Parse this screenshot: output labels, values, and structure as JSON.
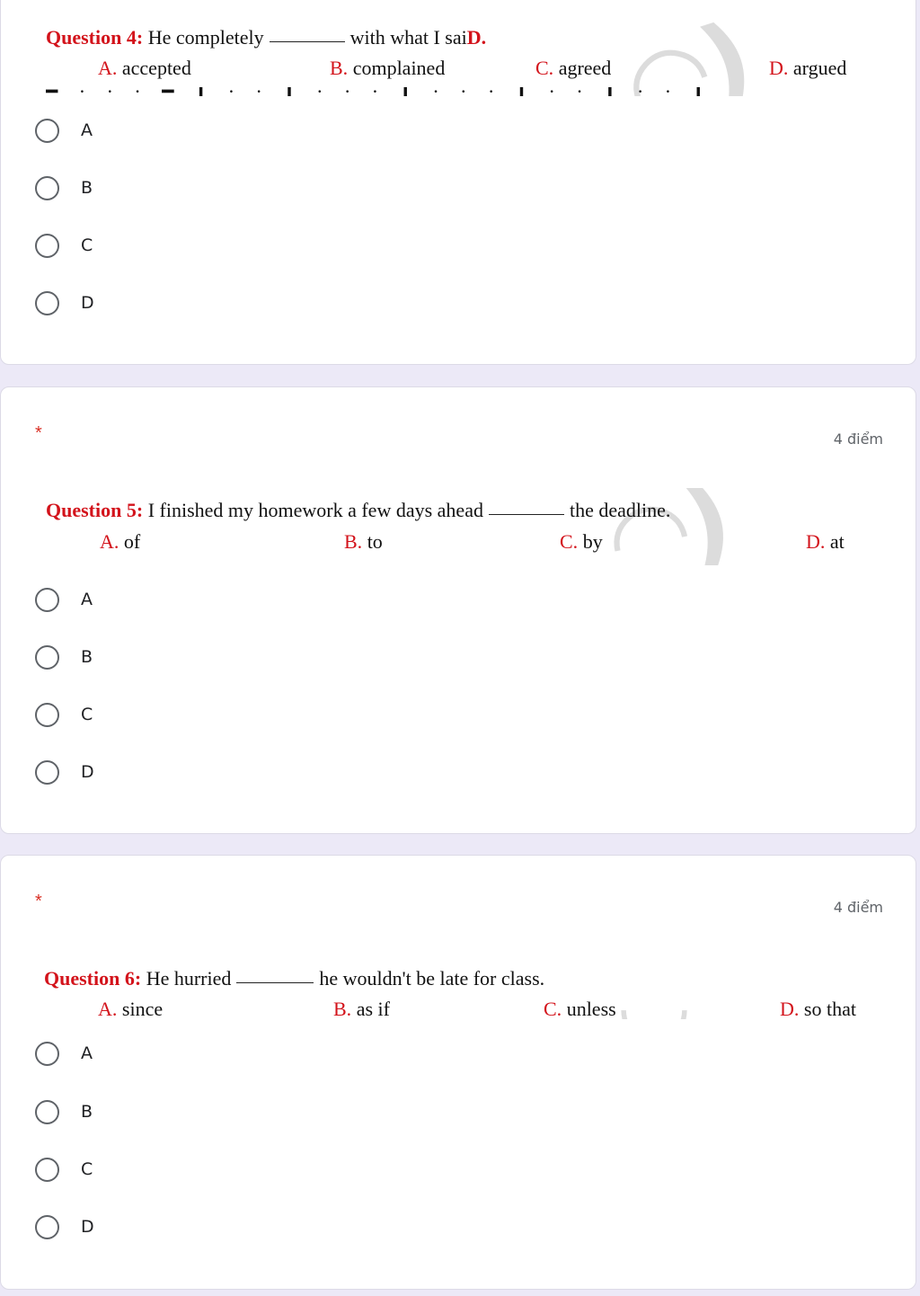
{
  "questions": [
    {
      "label": "Question 4:",
      "text_before": "He completely",
      "text_after": "with what I sai",
      "text_tail": "D.",
      "options": [
        {
          "letter": "A.",
          "text": "accepted"
        },
        {
          "letter": "B.",
          "text": "complained"
        },
        {
          "letter": "C.",
          "text": "agreed"
        },
        {
          "letter": "D.",
          "text": "argued"
        }
      ],
      "choices": [
        "A",
        "B",
        "C",
        "D"
      ]
    },
    {
      "required": "*",
      "points": "4 điểm",
      "label": "Question 5:",
      "text_before": "I finished my homework a few days ahead",
      "text_after": "the deadline.",
      "options": [
        {
          "letter": "A.",
          "text": "of"
        },
        {
          "letter": "B.",
          "text": "to"
        },
        {
          "letter": "C.",
          "text": "by"
        },
        {
          "letter": "D.",
          "text": "at"
        }
      ],
      "choices": [
        "A",
        "B",
        "C",
        "D"
      ]
    },
    {
      "required": "*",
      "points": "4 điểm",
      "label": "Question 6:",
      "text_before": "He hurried",
      "text_after": "he wouldn't be late for class.",
      "options": [
        {
          "letter": "A.",
          "text": "since"
        },
        {
          "letter": "B.",
          "text": "as if"
        },
        {
          "letter": "C.",
          "text": "unless"
        },
        {
          "letter": "D.",
          "text": "so that"
        }
      ],
      "choices": [
        "A",
        "B",
        "C",
        "D"
      ]
    }
  ]
}
